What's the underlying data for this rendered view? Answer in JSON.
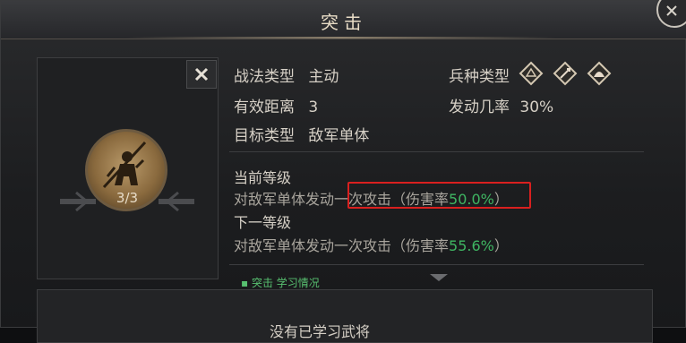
{
  "title": "突击",
  "skill": {
    "level_text": "3/3"
  },
  "info": {
    "tactic_type_label": "战法类型",
    "tactic_type_value": "主动",
    "range_label": "有效距离",
    "range_value": "3",
    "target_label": "目标类型",
    "target_value": "敌军单体",
    "troop_label": "兵种类型",
    "chance_label": "发动几率",
    "chance_value": "30%"
  },
  "troop_icons": [
    "cavalry-icon",
    "spear-icon",
    "archer-icon"
  ],
  "current_level": {
    "title": "当前等级",
    "desc_prefix": "对敌军单体发动一次攻击（伤害率",
    "value": "50.0%",
    "desc_suffix": "）"
  },
  "next_level": {
    "title": "下一等级",
    "desc_prefix": "对敌军单体发动一次攻击（伤害率",
    "value": "55.6%",
    "desc_suffix": "）"
  },
  "partial_subtitle": "▪ 突击  学习情况",
  "bottom_text": "没有已学习武将",
  "colors": {
    "accent_green": "#3fb562",
    "highlight_red": "#d9201f",
    "title_text": "#e8dcc6"
  }
}
